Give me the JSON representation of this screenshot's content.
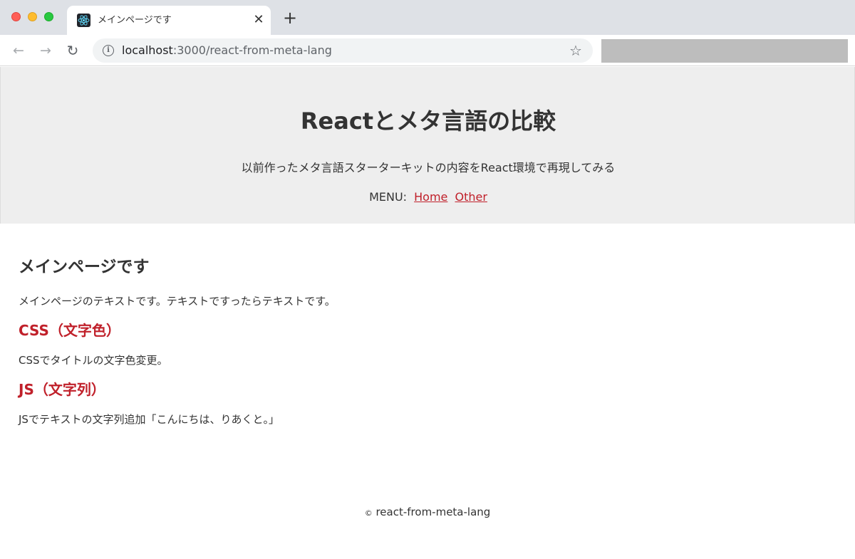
{
  "browser": {
    "tab_title": "メインページです",
    "tab_close": "✕",
    "new_tab": "+",
    "url_host": "localhost",
    "url_rest": ":3000/react-from-meta-lang"
  },
  "header": {
    "title": "Reactとメタ言語の比較",
    "description": "以前作ったメタ言語スターターキットの内容をReact環境で再現してみる",
    "menu_label": "MENU:",
    "menu_items": [
      {
        "label": "Home"
      },
      {
        "label": "Other"
      }
    ]
  },
  "main": {
    "heading": "メインページです",
    "intro": "メインページのテキストです。テキストですったらテキストです。",
    "sections": [
      {
        "heading": "CSS（文字色）",
        "text": "CSSでタイトルの文字色変更。"
      },
      {
        "heading": "JS（文字列）",
        "text": "JSでテキストの文字列追加「こんにちは、りあくと。」"
      }
    ]
  },
  "footer": {
    "copyright_symbol": "©",
    "text": "react-from-meta-lang"
  },
  "colors": {
    "accent_red": "#c0202a",
    "header_bg": "#eeeeee",
    "tabbar_bg": "#dee1e6"
  }
}
